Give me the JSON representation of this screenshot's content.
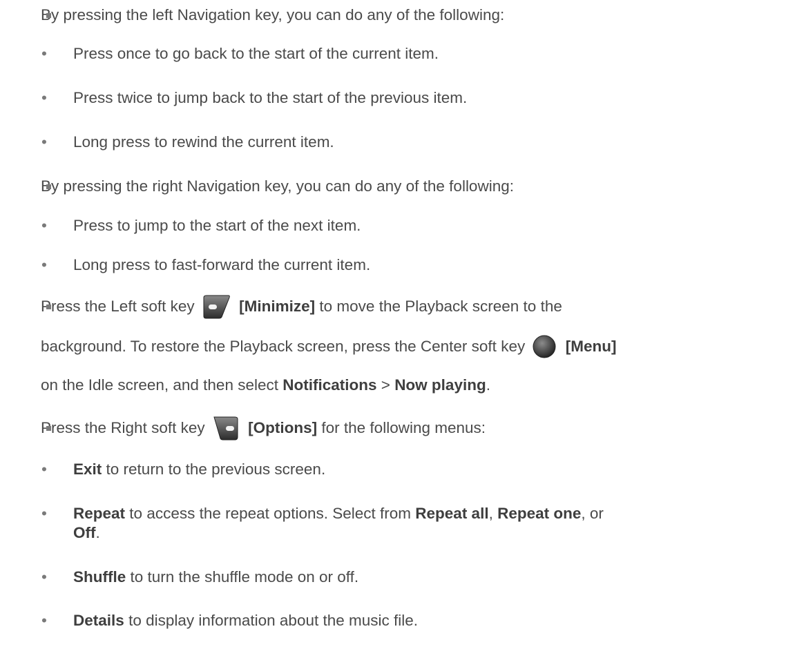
{
  "items": [
    {
      "text": "By pressing the left Navigation key, you can do any of the following:"
    },
    {
      "text": "Press once to go back to the start of the current item."
    },
    {
      "text": "Press twice to jump back to the start of the previous item."
    },
    {
      "text": "Long press to rewind the current item."
    },
    {
      "text": "By pressing the right Navigation key, you can do any of the following:"
    },
    {
      "text": "Press to jump to the start of the next item."
    },
    {
      "text": "Long press to fast-forward the current item."
    },
    {
      "pre": "Press the Left soft key",
      "key_label": "[Minimize]",
      "post": "to move the Playback screen to the"
    },
    {
      "pre": "background. To restore the Playback screen, press the Center soft key",
      "key_label": "[Menu]"
    },
    {
      "pre": "on the Idle screen, and then select",
      "b1": "Notifications",
      "sep": ">",
      "b2": "Now playing",
      "end": "."
    },
    {
      "pre": "Press the Right soft key",
      "key_label": "[Options]",
      "post": "for the following menus:"
    },
    {
      "b1": "Exit",
      "post": "to return to the previous screen."
    },
    {
      "b1": "Repeat",
      "mid": "to access the repeat options. Select from",
      "b2": "Repeat all",
      "c": ",",
      "b3": "Repeat one",
      "end": ", or"
    },
    {
      "b1": "Off",
      "end": "."
    },
    {
      "b1": "Shuffle",
      "post": "to turn the shuffle mode on or off."
    },
    {
      "b1": "Details",
      "post": "to display information about the music file."
    }
  ],
  "icons": {
    "left_soft_key": "left-soft-key-icon",
    "center_soft_key": "center-soft-key-icon",
    "right_soft_key": "right-soft-key-icon"
  },
  "bullets": {
    "level1": "■",
    "level2": "•"
  }
}
